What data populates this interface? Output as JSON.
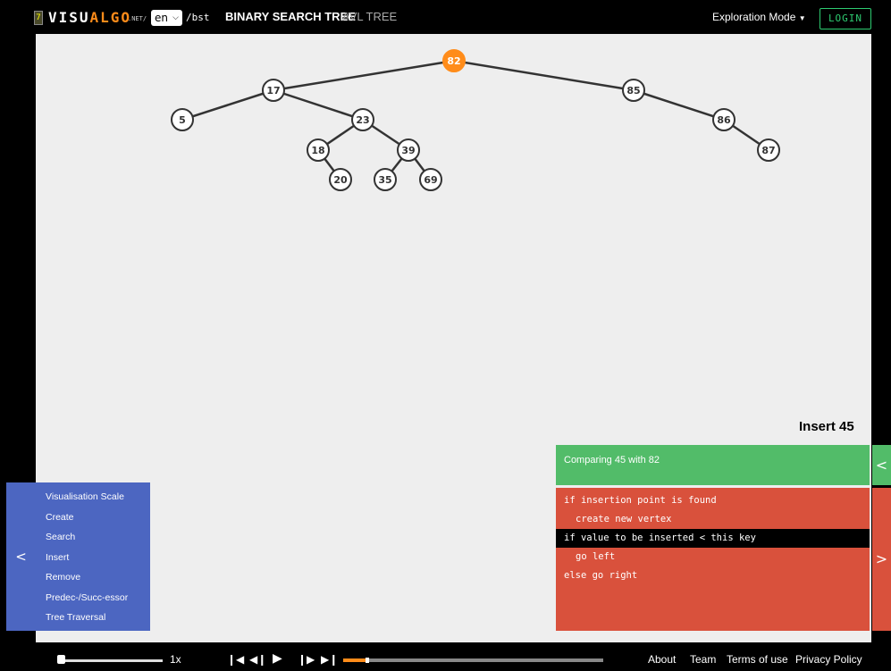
{
  "header": {
    "logo_mark": "7",
    "logo_part1": "VISU",
    "logo_part2": "ALGO",
    "logo_net": ".NET",
    "logo_slash": "/",
    "language": "en",
    "path": "/bst",
    "tab_bst": "BINARY SEARCH TREE",
    "tab_avl": "AVL TREE",
    "mode": "Exploration Mode",
    "login": "LOGIN"
  },
  "tree": {
    "nodes": [
      {
        "id": "82",
        "value": "82",
        "highlight": true
      },
      {
        "id": "17",
        "value": "17"
      },
      {
        "id": "85",
        "value": "85"
      },
      {
        "id": "5",
        "value": "5"
      },
      {
        "id": "23",
        "value": "23"
      },
      {
        "id": "86",
        "value": "86"
      },
      {
        "id": "18",
        "value": "18"
      },
      {
        "id": "39",
        "value": "39"
      },
      {
        "id": "87",
        "value": "87"
      },
      {
        "id": "20",
        "value": "20"
      },
      {
        "id": "35",
        "value": "35"
      },
      {
        "id": "69",
        "value": "69"
      }
    ],
    "edges": [
      [
        "82",
        "17"
      ],
      [
        "82",
        "85"
      ],
      [
        "17",
        "5"
      ],
      [
        "17",
        "23"
      ],
      [
        "85",
        "86"
      ],
      [
        "23",
        "18"
      ],
      [
        "23",
        "39"
      ],
      [
        "86",
        "87"
      ],
      [
        "18",
        "20"
      ],
      [
        "39",
        "35"
      ],
      [
        "39",
        "69"
      ]
    ],
    "highlight_color": "#ff8c1a"
  },
  "operation_title": "Insert 45",
  "status": {
    "text": "Comparing 45 with 82",
    "tab_icon": "<"
  },
  "code": {
    "lines": [
      {
        "text": "if insertion point is found",
        "active": false
      },
      {
        "text": "create new vertex",
        "active": false,
        "indent": true
      },
      {
        "text": "if value to be inserted < this key",
        "active": true
      },
      {
        "text": "go left",
        "active": false,
        "indent": true
      },
      {
        "text": "else go right",
        "active": false
      }
    ],
    "tab_icon": ">"
  },
  "actions": {
    "tab_icon": "<",
    "items": [
      "Visualisation Scale",
      "Create",
      "Search",
      "Insert",
      "Remove",
      "Predec-/Succ-essor",
      "Tree Traversal"
    ]
  },
  "playback": {
    "speed_label": "1x",
    "progress_fraction": 0.09
  },
  "footer": {
    "about": "About",
    "team": "Team",
    "terms": "Terms of use",
    "privacy": "Privacy Policy"
  },
  "colors": {
    "green": "#52bc69",
    "red": "#d9513c",
    "blue": "#4c66c1",
    "orange": "#ff8c1a"
  }
}
